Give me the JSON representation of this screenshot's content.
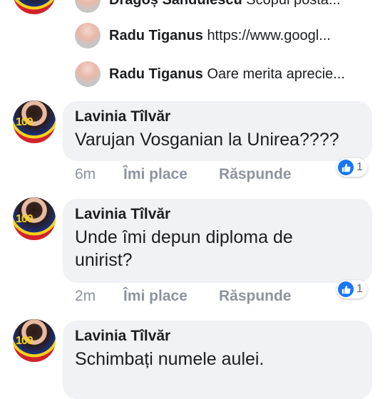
{
  "replies": [
    {
      "name": "Dragoș Sandulescu",
      "text": "Scopul postă..."
    },
    {
      "name": "Radu Tiganus",
      "text": "https://www.googl..."
    },
    {
      "name": "Radu Tiganus",
      "text": "Oare merita aprecie..."
    }
  ],
  "comments": [
    {
      "author": "Lavinia Tîlvăr",
      "lines": [
        "Varujan Vosganian la Unirea????"
      ],
      "time": "6m",
      "like_label": "Îmi place",
      "reply_label": "Răspunde",
      "reaction_count": "1"
    },
    {
      "author": "Lavinia Tîlvăr",
      "lines": [
        "Unde îmi depun diploma de",
        "unirist?"
      ],
      "time": "2m",
      "like_label": "Îmi place",
      "reply_label": "Răspunde",
      "reaction_count": "1"
    },
    {
      "author": "Lavinia Tîlvăr",
      "lines": [
        "Schimbați numele aulei."
      ],
      "time": "",
      "like_label": "",
      "reply_label": "",
      "reaction_count": ""
    }
  ],
  "avatar_badge": "100",
  "colors": {
    "like_blue": "#1877f2",
    "bubble": "#f0f2f5",
    "meta_gray": "#8d949e"
  }
}
